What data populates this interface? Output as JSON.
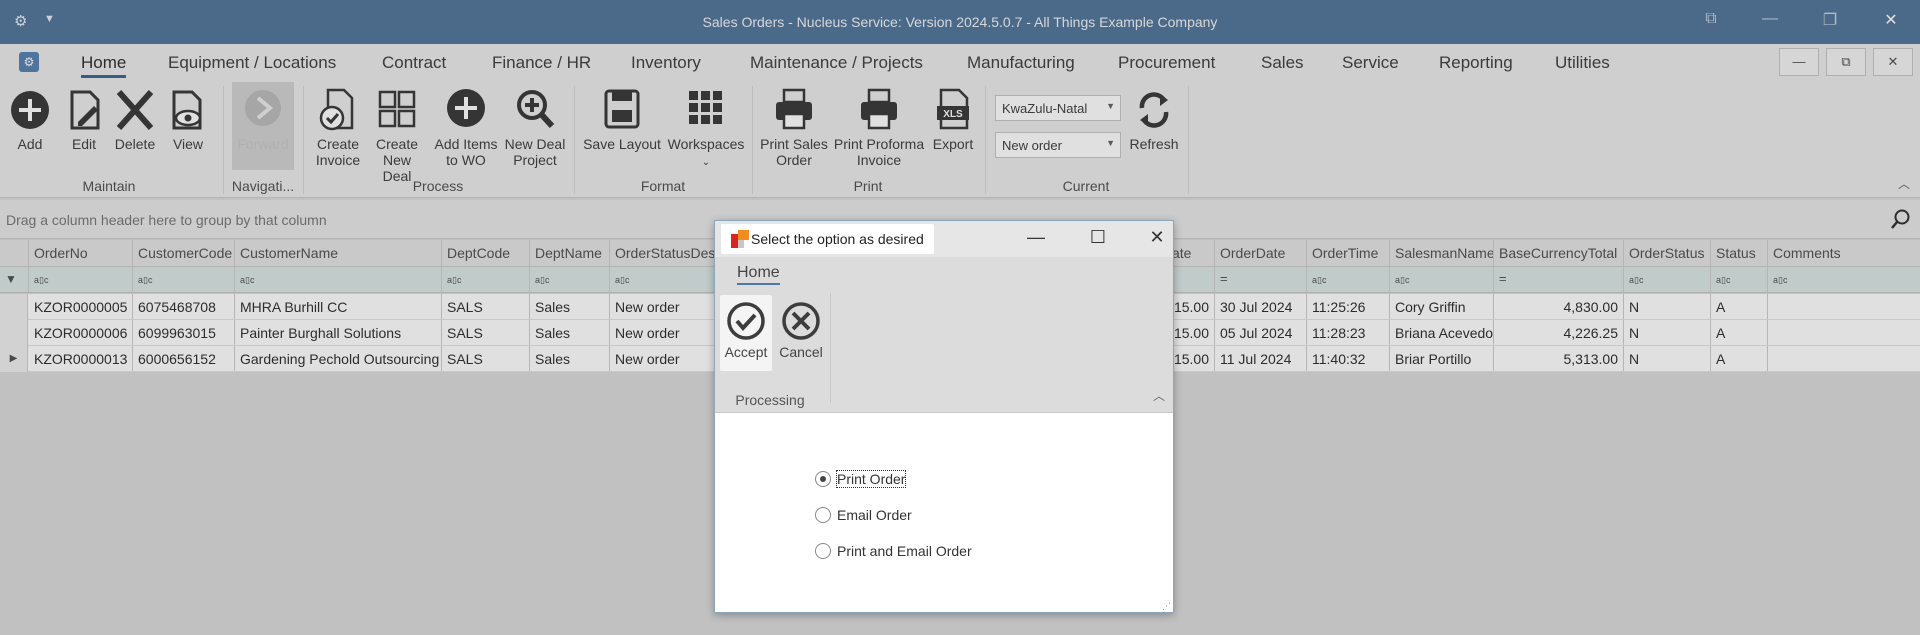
{
  "window": {
    "title": "Sales Orders - Nucleus Service: Version 2024.5.0.7 - All Things Example Company",
    "quick_access_icon": "gear-icon",
    "controls": [
      "restore-icon",
      "minimize-icon",
      "maximize-icon",
      "close-icon"
    ]
  },
  "menu": {
    "tabs": [
      "Home",
      "Equipment / Locations",
      "Contract",
      "Finance / HR",
      "Inventory",
      "Maintenance / Projects",
      "Manufacturing",
      "Procurement",
      "Sales",
      "Service",
      "Reporting",
      "Utilities"
    ],
    "active": "Home"
  },
  "ribbon": {
    "buttons": {
      "add": "Add",
      "edit": "Edit",
      "delete": "Delete",
      "view": "View",
      "forward": "Forward",
      "create_invoice_1": "Create",
      "create_invoice_2": "Invoice",
      "create_deal_1": "Create",
      "create_deal_2": "New Deal",
      "add_items_1": "Add Items",
      "add_items_2": "to WO",
      "new_deal_project_1": "New Deal",
      "new_deal_project_2": "Project",
      "save_layout": "Save Layout",
      "workspaces": "Workspaces",
      "print_sales_1": "Print Sales",
      "print_sales_2": "Order",
      "print_proforma_1": "Print Proforma",
      "print_proforma_2": "Invoice",
      "export": "Export",
      "refresh": "Refresh"
    },
    "groups": {
      "maintain": "Maintain",
      "navigation": "Navigati...",
      "process": "Process",
      "format": "Format",
      "print": "Print",
      "current": "Current"
    },
    "region_combo": "KwaZulu-Natal",
    "status_combo": "New order"
  },
  "grid": {
    "group_panel_hint": "Drag a column header here to group by that column",
    "filter_glyph": "a▯c",
    "filter_eq": "=",
    "columns": {
      "order_no": "OrderNo",
      "customer_code": "CustomerCode",
      "customer_name": "CustomerName",
      "dept_code": "DeptCode",
      "dept_name": "DeptName",
      "order_status_desc": "OrderStatusDes",
      "rate": "ate",
      "order_date": "OrderDate",
      "order_time": "OrderTime",
      "salesman_name": "SalesmanName",
      "base_currency_total": "BaseCurrencyTotal",
      "order_status": "OrderStatus",
      "status": "Status",
      "comments": "Comments"
    },
    "rows": [
      {
        "order_no": "KZOR0000005",
        "customer_code": "6075468708",
        "customer_name": "MHRA Burhill CC",
        "dept_code": "SALS",
        "dept_name": "Sales",
        "order_status_desc": "New order",
        "rate": "15.00",
        "order_date": "30 Jul 2024",
        "order_time": "11:25:26",
        "salesman_name": "Cory Griffin",
        "base_currency_total": "4,830.00",
        "order_status": "N",
        "status": "A",
        "comments": ""
      },
      {
        "order_no": "KZOR0000006",
        "customer_code": "6099963015",
        "customer_name": "Painter Burghall Solutions",
        "dept_code": "SALS",
        "dept_name": "Sales",
        "order_status_desc": "New order",
        "rate": "15.00",
        "order_date": "05 Jul 2024",
        "order_time": "11:28:23",
        "salesman_name": "Briana Acevedo",
        "base_currency_total": "4,226.25",
        "order_status": "N",
        "status": "A",
        "comments": ""
      },
      {
        "order_no": "KZOR0000013",
        "customer_code": "6000656152",
        "customer_name": "Gardening Pechold Outsourcing",
        "dept_code": "SALS",
        "dept_name": "Sales",
        "order_status_desc": "New order",
        "rate": "15.00",
        "order_date": "11 Jul 2024",
        "order_time": "11:40:32",
        "salesman_name": "Briar Portillo",
        "base_currency_total": "5,313.00",
        "order_status": "N",
        "status": "A",
        "comments": ""
      }
    ]
  },
  "dialog": {
    "title": "Select the option as desired",
    "tab": "Home",
    "accept": "Accept",
    "cancel": "Cancel",
    "group": "Processing",
    "options": [
      "Print Order",
      "Email Order",
      "Print and Email Order"
    ],
    "selected_option": "Print Order"
  },
  "colors": {
    "titlebar": "#56799c",
    "accent": "#3e6a94",
    "filter_row": "#dbe8e6"
  }
}
